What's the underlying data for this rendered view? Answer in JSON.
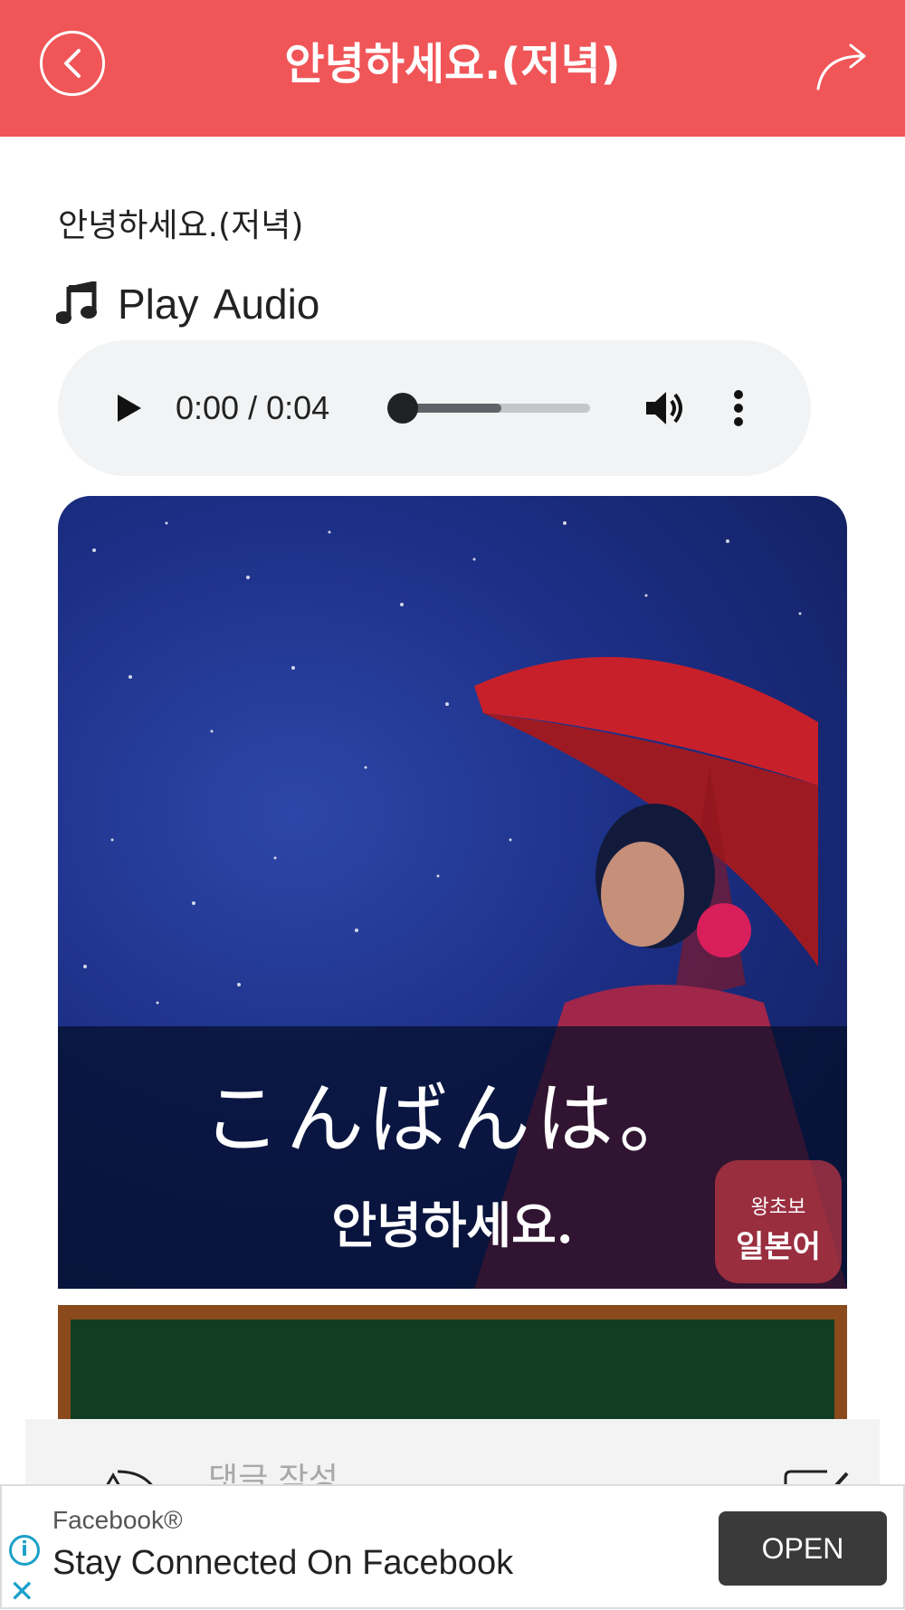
{
  "header": {
    "title": "안녕하세요.(저녁)",
    "background_color": "#f05558",
    "back_icon": "chevron-left-icon",
    "share_icon": "share-arrow-icon"
  },
  "page": {
    "label": "안녕하세요.(저녁)"
  },
  "audio": {
    "heading_icon": "music-note-icon",
    "heading": "Play  Audio",
    "time": "0:00 / 0:04",
    "progress": 0.0,
    "buffered": 0.55
  },
  "lesson_image": {
    "japanese": "こんばんは。",
    "korean": "안녕하세요.",
    "logo_line1": "왕초보",
    "logo_line2": "일본어"
  },
  "comment": {
    "placeholder": "댓글 작성"
  },
  "ad": {
    "brand": "Facebook®",
    "title": "Stay Connected On Facebook",
    "button": "OPEN",
    "accent_color": "#1aa0c8"
  }
}
